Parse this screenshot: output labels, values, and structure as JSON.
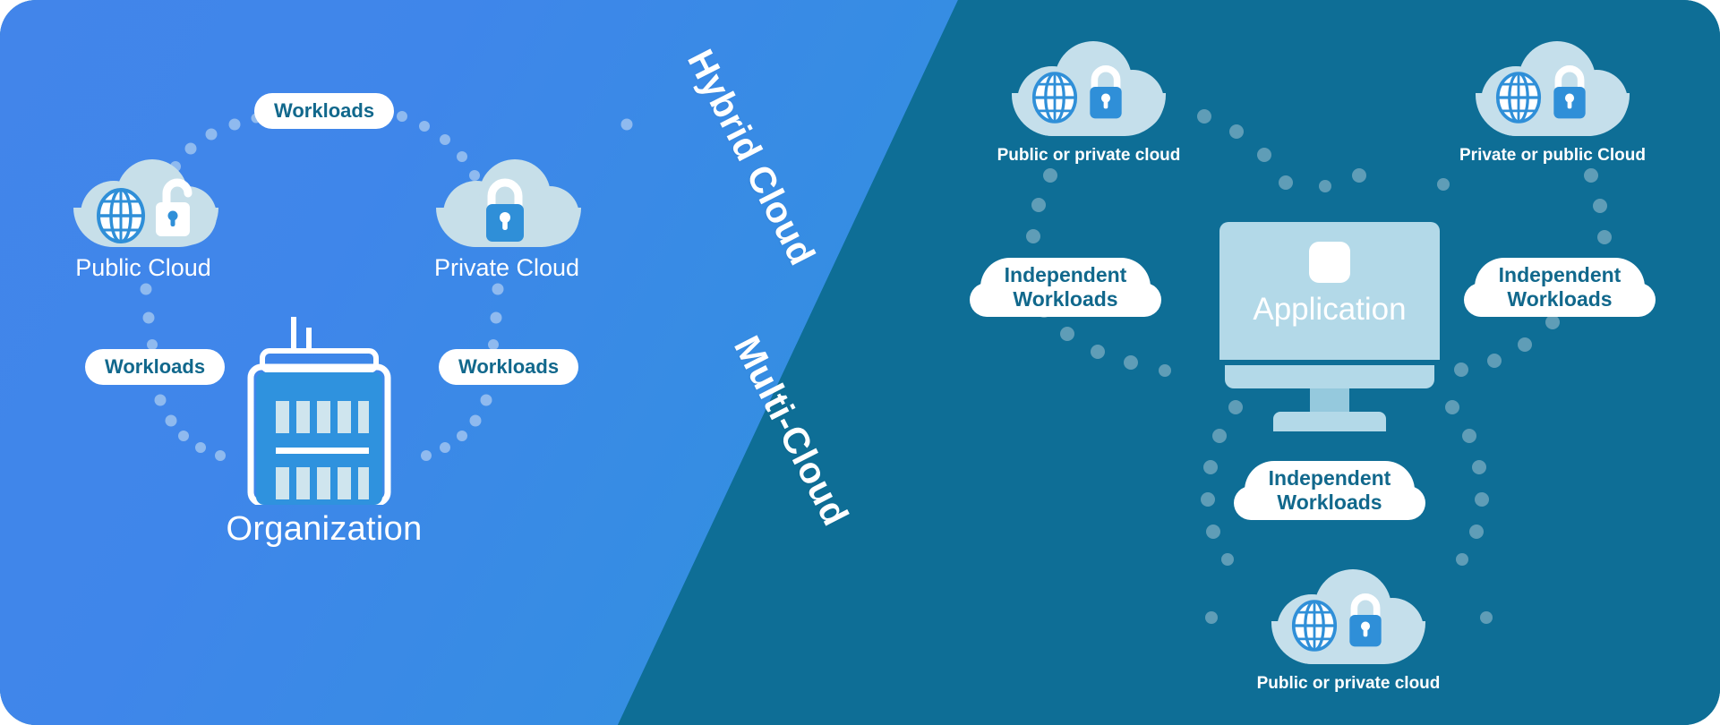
{
  "colors": {
    "left_panel_start": "#4285ea",
    "left_panel_end": "#2196d4",
    "right_panel": "#0e6e96",
    "cloud_fill": "#c5dfeb",
    "pill_bg": "#ffffff",
    "pill_text": "#11688c",
    "accent_blue": "#2f8fd8",
    "white": "#ffffff",
    "dot_left": "#8fb9ef",
    "dot_right": "#5e9cb5"
  },
  "diagram": {
    "type": "concept-diagram",
    "title_left": "Hybrid Cloud",
    "title_right": "Multi-Cloud"
  },
  "left_panel": {
    "title": "Hybrid Cloud",
    "nodes": {
      "public_cloud": {
        "label": "Public Cloud",
        "icons": [
          "globe-icon",
          "unlocked-padlock-icon"
        ]
      },
      "private_cloud": {
        "label": "Private Cloud",
        "icons": [
          "globe-icon",
          "locked-padlock-icon"
        ]
      },
      "organization": {
        "label": "Organization",
        "icons": [
          "office-building-icon"
        ]
      }
    },
    "connector_pills": [
      {
        "id": "workloads-top",
        "label": "Workloads"
      },
      {
        "id": "workloads-left",
        "label": "Workloads"
      },
      {
        "id": "workloads-right",
        "label": "Workloads"
      }
    ]
  },
  "right_panel": {
    "title": "Multi-Cloud",
    "center": {
      "label": "Application",
      "icon": "monitor-icon"
    },
    "clouds": [
      {
        "id": "cloud-top-left",
        "label": "Public or private cloud",
        "icons": [
          "globe-icon",
          "locked-padlock-icon"
        ]
      },
      {
        "id": "cloud-top-right",
        "label": "Private or public Cloud",
        "icons": [
          "globe-icon",
          "locked-padlock-icon"
        ]
      },
      {
        "id": "cloud-bottom",
        "label": "Public or private cloud",
        "icons": [
          "globe-icon",
          "locked-padlock-icon"
        ]
      }
    ],
    "connector_pills": [
      {
        "id": "independent-left",
        "line1": "Independent",
        "line2": "Workloads"
      },
      {
        "id": "independent-right",
        "line1": "Independent",
        "line2": "Workloads"
      },
      {
        "id": "independent-bottom",
        "line1": "Independent",
        "line2": "Workloads"
      }
    ]
  }
}
